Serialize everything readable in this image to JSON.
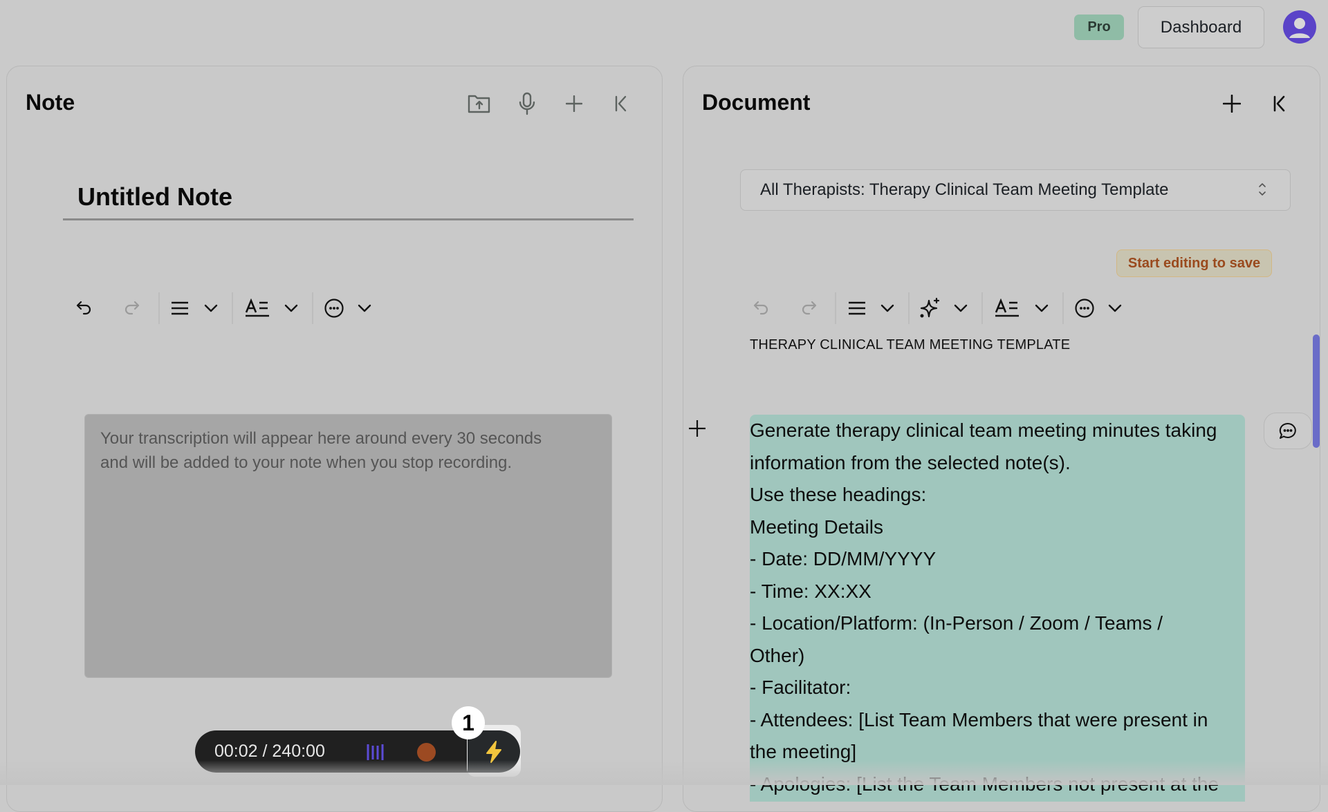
{
  "header": {
    "plan_badge": "Pro",
    "dashboard_label": "Dashboard",
    "avatar_icon": "user-avatar-icon",
    "avatar_color": "#5a43c8"
  },
  "note_panel": {
    "title": "Note",
    "actions": [
      "upload-folder-icon",
      "microphone-icon",
      "plus-icon",
      "collapse-left-icon"
    ],
    "note_title": "Untitled Note",
    "toolbar": [
      "undo-icon",
      "redo-icon",
      "align-icon",
      "chevron-down-icon",
      "text-style-icon",
      "chevron-down-icon",
      "more-icon",
      "chevron-down-icon"
    ],
    "transcription_placeholder_line1": "Your transcription will appear here around every 30 seconds",
    "transcription_placeholder_line2": "and will be added to your note when you stop recording."
  },
  "recorder": {
    "elapsed": "00:02",
    "limit": "240:00",
    "time_display": "00:02 / 240:00",
    "wave_color": "#5b4bd6",
    "record_color": "#9c4a22",
    "bolt_color": "#f2c53d",
    "step_badge": "1"
  },
  "document_panel": {
    "title": "Document",
    "actions": [
      "plus-icon",
      "collapse-left-icon"
    ],
    "template_selected": "All Therapists: Therapy Clinical Team Meeting Template",
    "save_status": "Start editing to save",
    "save_status_color": "#9a4a1e",
    "toolbar": [
      "undo-icon",
      "redo-icon",
      "align-icon",
      "chevron-down-icon",
      "ai-sparkle-icon",
      "chevron-down-icon",
      "text-style-icon",
      "chevron-down-icon",
      "more-icon",
      "chevron-down-icon"
    ],
    "heading": "THERAPY CLINICAL TEAM MEETING TEMPLATE",
    "highlight_color": "#a0c6bd",
    "lines": [
      "Generate therapy clinical team meeting minutes taking",
      "information from the selected note(s).",
      "Use these headings:",
      "Meeting Details",
      "- Date: DD/MM/YYYY",
      "- Time: XX:XX",
      "- Location/Platform: (In-Person / Zoom / Teams /",
      "Other)",
      "- Facilitator:",
      "- Attendees: [List Team Members that were present in",
      "the meeting]",
      "- Apologies: [List the Team Members not present at the"
    ]
  }
}
